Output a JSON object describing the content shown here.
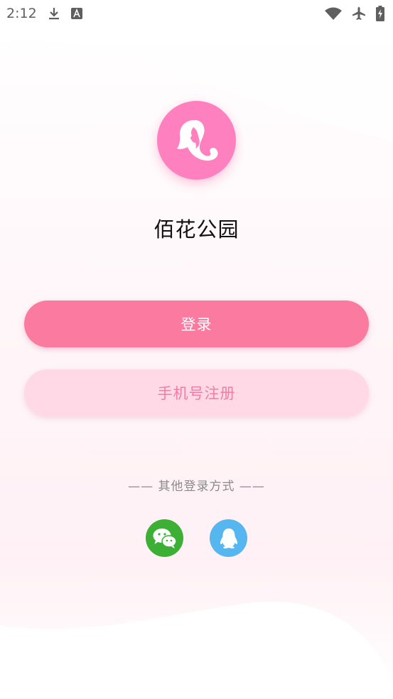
{
  "status_bar": {
    "time": "2:12",
    "icons": [
      "download-icon",
      "font-icon",
      "wifi-icon",
      "airplane-mode-icon",
      "battery-charging-icon"
    ]
  },
  "app": {
    "name": "佰花公园",
    "logo_icon": "woman-silhouette-icon"
  },
  "buttons": {
    "login_label": "登录",
    "register_label": "手机号注册"
  },
  "other_login": {
    "label": "—— 其他登录方式 ——",
    "methods": [
      {
        "name": "wechat",
        "icon": "wechat-icon",
        "color": "#3cb034"
      },
      {
        "name": "qq",
        "icon": "qq-icon",
        "color": "#56b6ef"
      }
    ]
  },
  "colors": {
    "primary": "#fb7aa0",
    "secondary_bg": "#ffd9e5",
    "secondary_text": "#f27ca3",
    "logo_bg": "#ff80bf"
  }
}
